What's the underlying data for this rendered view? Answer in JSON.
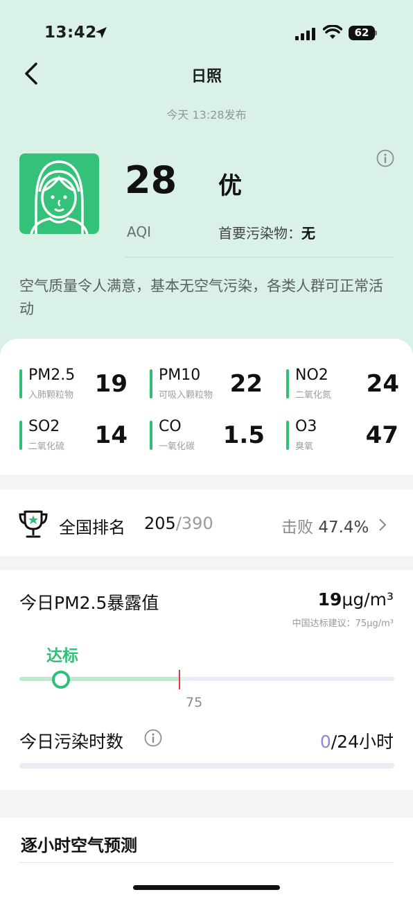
{
  "status_bar": {
    "time": "13:42",
    "battery": "62"
  },
  "header": {
    "title": "日照",
    "publish_time": "今天 13:28发布"
  },
  "aqi": {
    "value": "28",
    "level": "优",
    "label": "AQI",
    "primary_pollutant_label": "首要污染物：",
    "primary_pollutant_value": "无",
    "description": "空气质量令人满意，基本无空气污染，各类人群可正常活动"
  },
  "pollutants": [
    {
      "name": "PM2.5",
      "sub": "入肺颗粒物",
      "value": "19"
    },
    {
      "name": "PM10",
      "sub": "可吸入颗粒物",
      "value": "22"
    },
    {
      "name": "NO2",
      "sub": "二氧化氮",
      "value": "24"
    },
    {
      "name": "SO2",
      "sub": "二氧化硫",
      "value": "14"
    },
    {
      "name": "CO",
      "sub": "一氧化碳",
      "value": "1.5"
    },
    {
      "name": "O3",
      "sub": "臭氧",
      "value": "47"
    }
  ],
  "ranking": {
    "label": "全国排名",
    "rank": "205",
    "total": "/390",
    "beat_label": "击败 ",
    "beat_value": "47.4%"
  },
  "exposure": {
    "title": "今日PM2.5暴露值",
    "value": "19",
    "unit": "μg/m³",
    "note": "中国达标建议：75μg/m³",
    "status": "达标",
    "limit_label": "75",
    "level_fraction": 0.11,
    "fill_fraction": 0.43
  },
  "pollution_hours": {
    "label": "今日污染时数",
    "value": "0",
    "total": "/24小时"
  },
  "forecast": {
    "title": "逐小时空气预测"
  },
  "colors": {
    "accent": "#2fbf76",
    "header_bg": "#d9f1e6",
    "limit_line": "#e0383e",
    "hours_zero": "#8e86d8"
  }
}
